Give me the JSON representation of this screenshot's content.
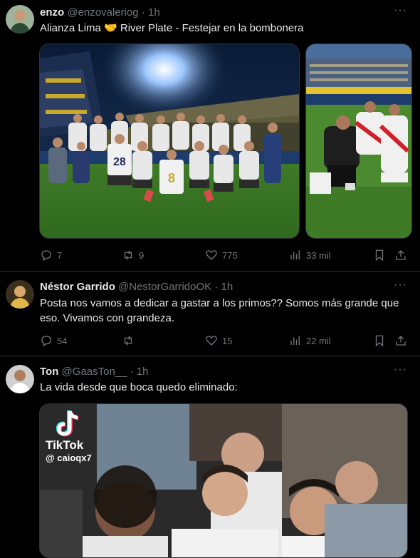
{
  "tweets": [
    {
      "name": "enzo",
      "handle": "@enzovaleriog",
      "dot": "·",
      "time": "1h",
      "more": "···",
      "text": "Alianza Lima 🤝 River Plate - Festejar en la bombonera",
      "replies": "7",
      "retweets": "9",
      "likes": "775",
      "views": "33 mil"
    },
    {
      "name": "Néstor Garrido",
      "handle": "@NestorGarridoOK",
      "dot": "·",
      "time": "1h",
      "more": "···",
      "text": "Posta nos vamos a dedicar a gastar a los primos?? Somos más grande que eso. Vivamos con grandeza.",
      "replies": "54",
      "retweets": "",
      "likes": "15",
      "views": "22 mil"
    },
    {
      "name": "Ton",
      "handle": "@GaasTon__",
      "dot": "·",
      "time": "1h",
      "more": "···",
      "text": "La vida desde que boca quedo eliminado:",
      "video_brand": "TikTok",
      "video_user": "@ caioqx7"
    }
  ],
  "photo_jersey_numbers": [
    "28",
    "8"
  ],
  "colors": {
    "background": "#000000",
    "text": "#e7e9ea",
    "secondary": "#71767b",
    "divider": "#2f3336",
    "grass": "#3f7a28"
  }
}
